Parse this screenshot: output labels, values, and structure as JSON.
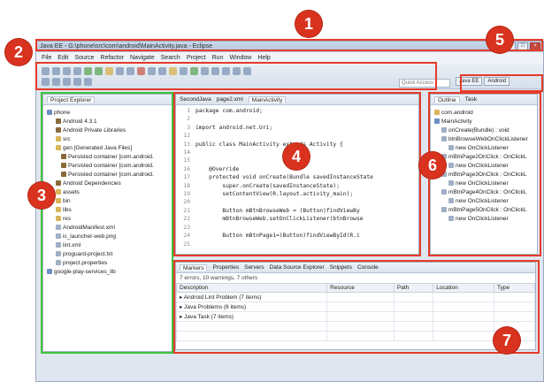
{
  "window": {
    "title": "Java EE - G:\\phone\\src\\com\\android\\MainActivity.java - Eclipse"
  },
  "menu": [
    "File",
    "Edit",
    "Source",
    "Refactor",
    "Navigate",
    "Search",
    "Project",
    "Run",
    "Window",
    "Help"
  ],
  "toolbar": {
    "quick_access": "Quick Access",
    "perspectives": [
      "Java EE",
      "Android"
    ]
  },
  "project_explorer": {
    "tab": "Project Explorer",
    "items": [
      {
        "label": "phone",
        "icon": "project-icon"
      },
      {
        "label": "Android 4.3.1",
        "icon": "library-icon"
      },
      {
        "label": "Android Private Libraries",
        "icon": "library-icon"
      },
      {
        "label": "src",
        "icon": "folder-icon"
      },
      {
        "label": "gen [Generated Java Files]",
        "icon": "folder-icon"
      },
      {
        "label": "Persisted container [com.android.",
        "icon": "jar-icon"
      },
      {
        "label": "Persisted container [com.android.",
        "icon": "jar-icon"
      },
      {
        "label": "Persisted container [com.android.",
        "icon": "jar-icon"
      },
      {
        "label": "Android Dependencies",
        "icon": "library-icon"
      },
      {
        "label": "assets",
        "icon": "folder-icon"
      },
      {
        "label": "bin",
        "icon": "folder-icon"
      },
      {
        "label": "libs",
        "icon": "folder-icon"
      },
      {
        "label": "res",
        "icon": "folder-icon"
      },
      {
        "label": "AndroidManifest.xml",
        "icon": "file-icon"
      },
      {
        "label": "ic_launcher-web.png",
        "icon": "file-icon"
      },
      {
        "label": "lint.xml",
        "icon": "file-icon"
      },
      {
        "label": "proguard-project.txt",
        "icon": "file-icon"
      },
      {
        "label": "project.properties",
        "icon": "file-icon"
      },
      {
        "label": "google-play-services_lib",
        "icon": "project-icon"
      }
    ]
  },
  "editor": {
    "tabs": [
      "SecondJava",
      "page2.xml",
      "MainActivity"
    ],
    "lines": [
      {
        "n": "1",
        "text": "package com.android;"
      },
      {
        "n": "2",
        "text": ""
      },
      {
        "n": "3",
        "text": "import android.net.Uri;"
      },
      {
        "n": "12",
        "text": ""
      },
      {
        "n": "13",
        "text": "public class MainActivity extends Activity {"
      },
      {
        "n": "14",
        "text": ""
      },
      {
        "n": "15",
        "text": ""
      },
      {
        "n": "16",
        "text": "    @Override"
      },
      {
        "n": "17",
        "text": "    protected void onCreate(Bundle savedInstanceState"
      },
      {
        "n": "18",
        "text": "        super.onCreate(savedInstanceState);"
      },
      {
        "n": "19",
        "text": "        setContentView(R.layout.activity_main);"
      },
      {
        "n": "20",
        "text": ""
      },
      {
        "n": "21",
        "text": "        Button mBtnBrowseWeb = (Button)findViewBy"
      },
      {
        "n": "22",
        "text": "        mBtnBrowseWeb.setOnClickListener(btnBrowse"
      },
      {
        "n": "23",
        "text": ""
      },
      {
        "n": "24",
        "text": "        Button mBtnPage1=(Button)findViewById(R.i"
      },
      {
        "n": "25",
        "text": ""
      }
    ]
  },
  "outline": {
    "tabs": [
      "Outline",
      "Task"
    ],
    "items": [
      "com.android",
      "MainActivity",
      "onCreate(Bundle) : void",
      "btnBrowseWebOnClickListener",
      "new OnClickListener",
      "mBtnPage2OnClick : OnClickL",
      "new OnClickListener",
      "mBtnPage3OnClick : OnClickL",
      "new OnClickListener",
      "mBtnPage4OnClick : OnClickL",
      "new OnClickListener",
      "mBtnPage5OnClick : OnClickL",
      "new OnClickListener"
    ]
  },
  "bottom": {
    "tabs": [
      "Markers",
      "Properties",
      "Servers",
      "Data Source Explorer",
      "Snippets",
      "Console"
    ],
    "summary": "7 errors, 10 warnings, 7 others",
    "columns": [
      "Description",
      "Resource",
      "Path",
      "Location",
      "Type"
    ],
    "rows": [
      "Android Lint Problem (7 items)",
      "Java Problems (6 items)",
      "Java Task (7 items)"
    ]
  },
  "annotations": [
    "1",
    "2",
    "3",
    "4",
    "5",
    "6",
    "7"
  ]
}
